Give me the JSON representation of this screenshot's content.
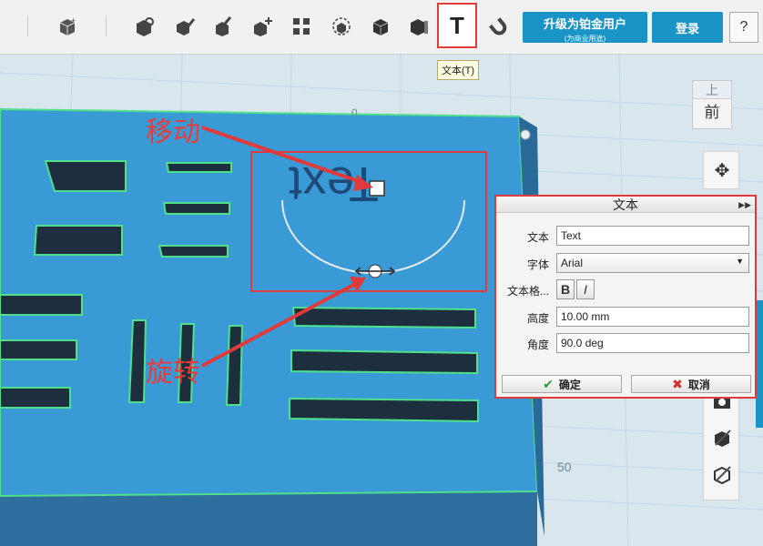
{
  "toolbar": {
    "tools": [
      {
        "icon": "add-cube-icon"
      },
      {
        "icon": "cube-group-icon"
      },
      {
        "icon": "draw-pencil-icon"
      },
      {
        "icon": "paint-brush-icon"
      },
      {
        "icon": "move-cube-icon"
      },
      {
        "icon": "pattern-icon"
      },
      {
        "icon": "snap-cube-icon"
      },
      {
        "icon": "solid-cube-icon"
      },
      {
        "icon": "material-cube-icon"
      },
      {
        "icon": "text-tool-icon",
        "label": "T"
      },
      {
        "icon": "magnet-icon"
      }
    ],
    "upgrade_label": "升级为铂金用户",
    "upgrade_sub": "(为商业用途)",
    "login_label": "登录",
    "help_label": "?",
    "tooltip": "文本(T)"
  },
  "scene": {
    "text_object": "Text",
    "ruler_top": "0",
    "ruler_bottom": "50"
  },
  "viewcube": {
    "top_label": "上",
    "front_label": "前"
  },
  "annotations": {
    "move": "移动",
    "rotate": "旋转"
  },
  "dialog": {
    "title": "文本",
    "fields": {
      "text_label": "文本",
      "text_value": "Text",
      "font_label": "字体",
      "font_value": "Arial",
      "style_label": "文本格...",
      "bold": "B",
      "italic": "I",
      "height_label": "高度",
      "height_value": "10.00 mm",
      "angle_label": "角度",
      "angle_value": "90.0 deg"
    },
    "ok_label": "确定",
    "cancel_label": "取消"
  },
  "colors": {
    "accent": "#1a93c7",
    "highlight": "#e03a3a",
    "plate": "#3a9ad6"
  }
}
